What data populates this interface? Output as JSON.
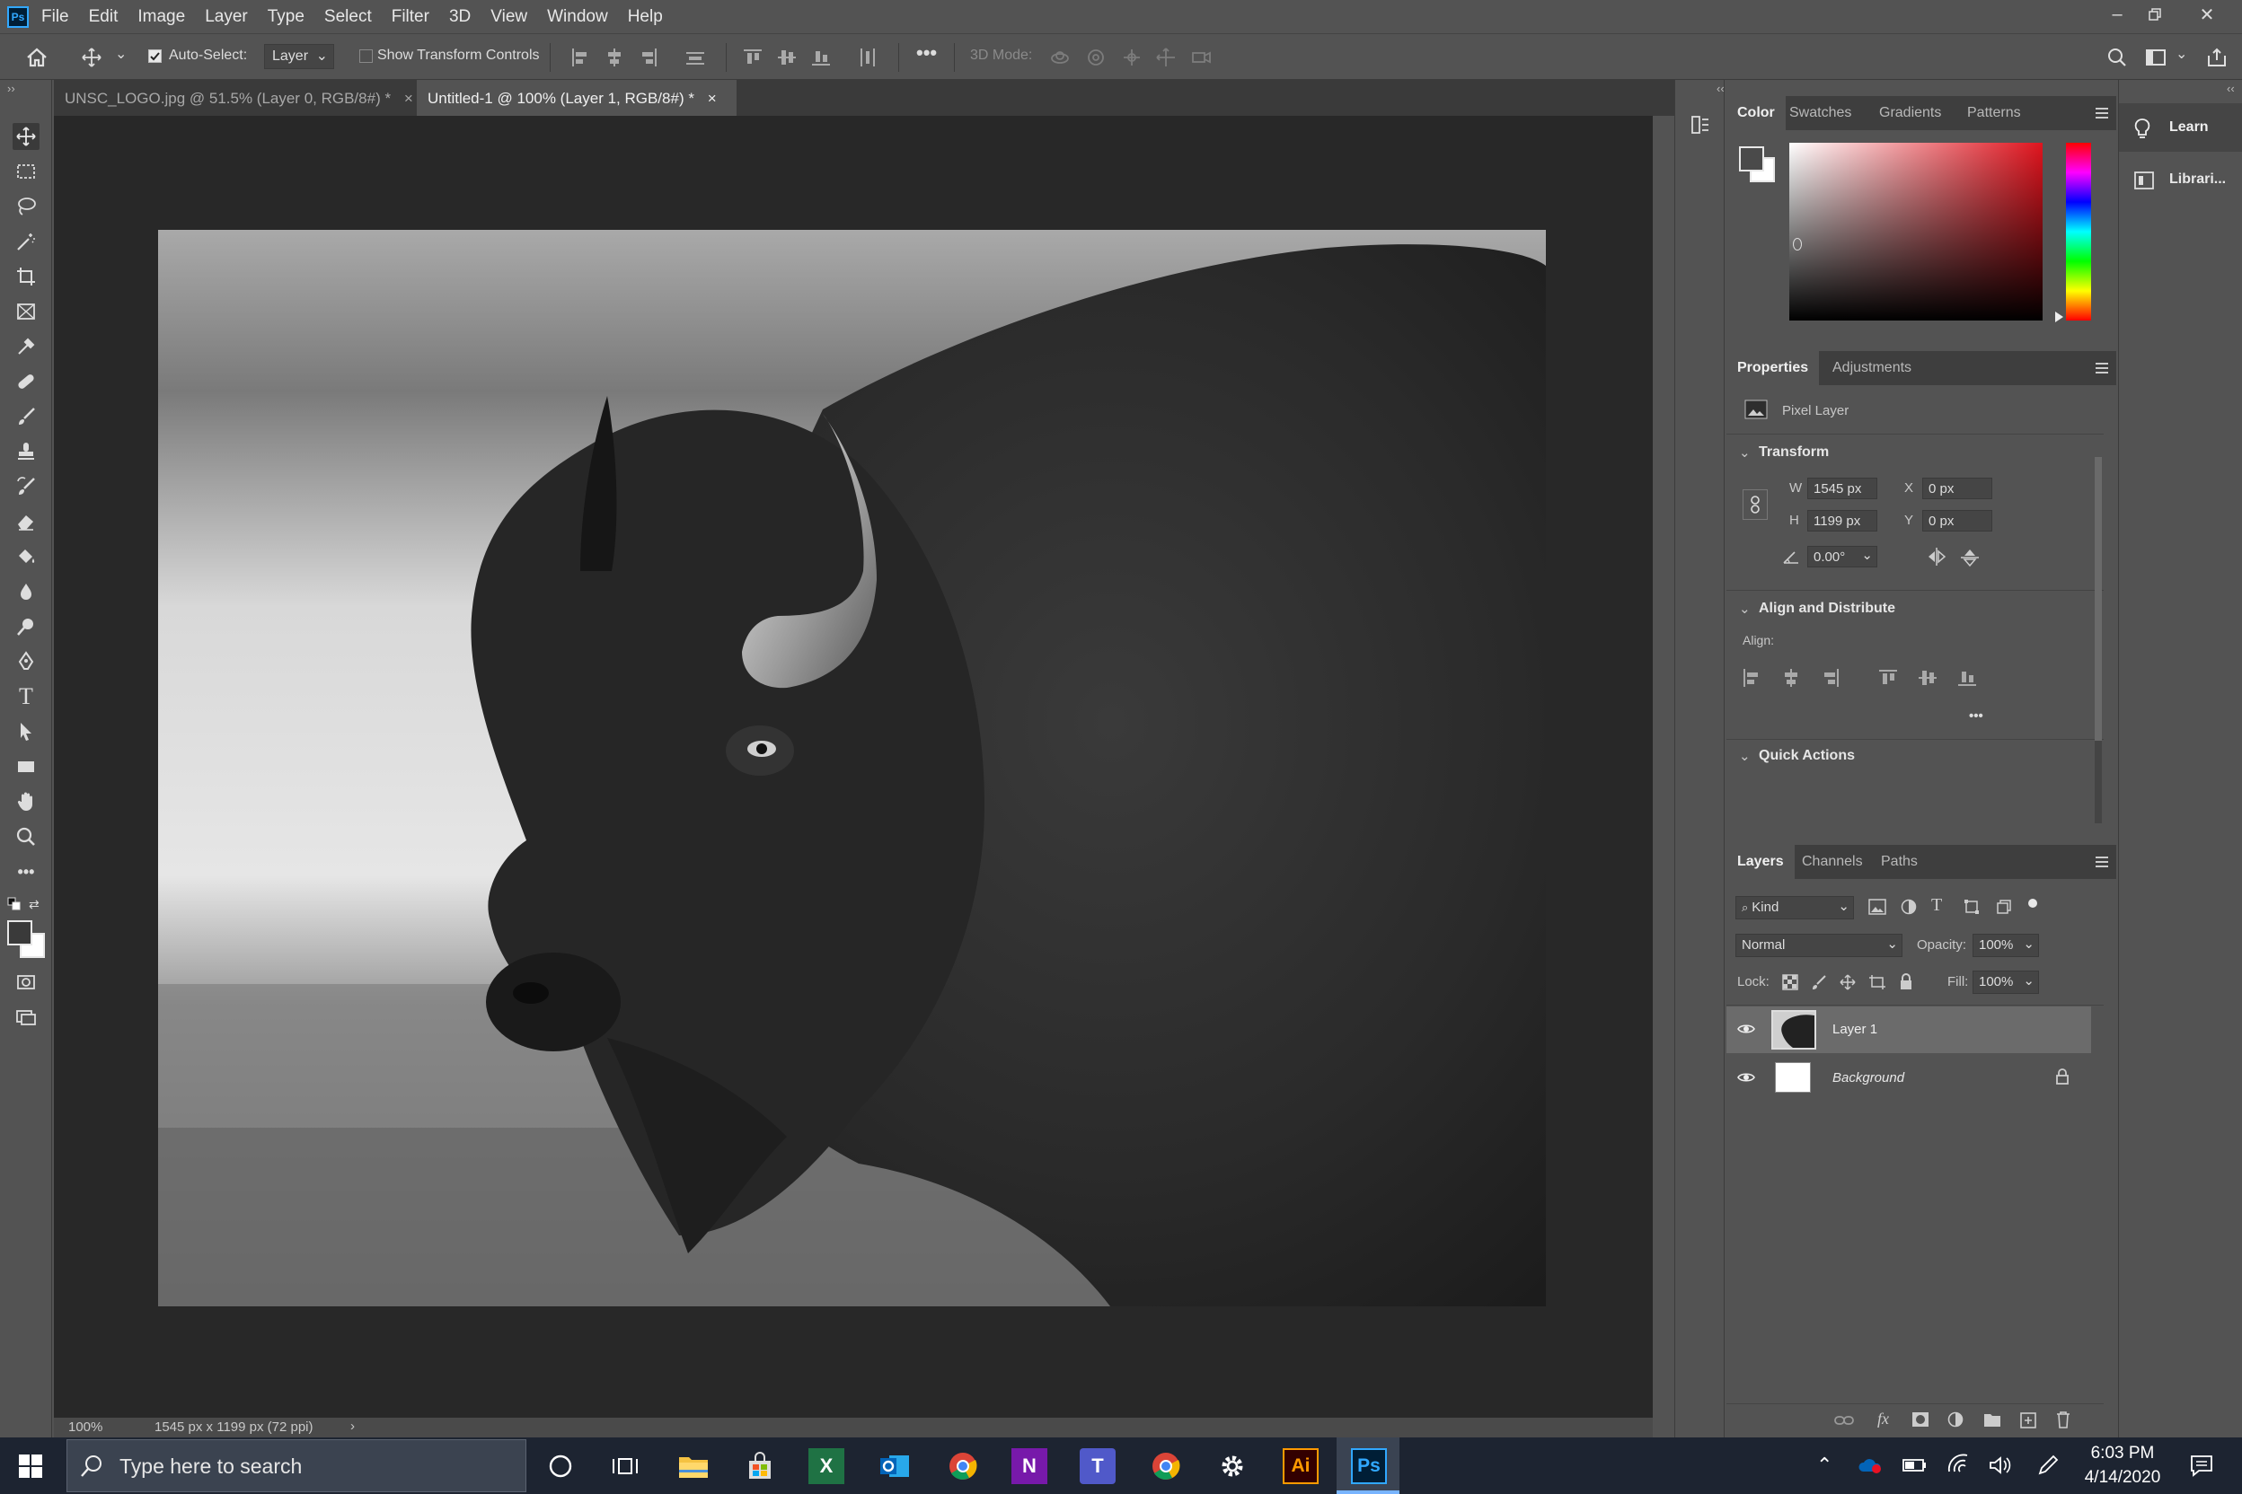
{
  "app": {
    "logo": "Ps"
  },
  "menu": [
    "File",
    "Edit",
    "Image",
    "Layer",
    "Type",
    "Select",
    "Filter",
    "3D",
    "View",
    "Window",
    "Help"
  ],
  "options_bar": {
    "auto_select_label": "Auto-Select:",
    "auto_select_checked": true,
    "auto_select_target": "Layer",
    "show_transform_label": "Show Transform Controls",
    "mode3d_label": "3D Mode:"
  },
  "tabs": [
    {
      "label": "UNSC_LOGO.jpg @ 51.5% (Layer 0, RGB/8#) *",
      "close": "×",
      "active": false
    },
    {
      "label": "Untitled-1 @ 100% (Layer 1, RGB/8#) *",
      "close": "×",
      "active": true
    }
  ],
  "status": {
    "zoom": "100%",
    "dimensions": "1545 px x 1199 px (72 ppi)",
    "arrow": "›"
  },
  "color_panel": {
    "tabs": [
      "Color",
      "Swatches",
      "Gradients",
      "Patterns"
    ],
    "active": "Color",
    "hue_color": "#e0141e"
  },
  "properties_panel": {
    "tabs": [
      "Properties",
      "Adjustments"
    ],
    "active": "Properties",
    "layer_type": "Pixel Layer",
    "transform_title": "Transform",
    "w_label": "W",
    "w_value": "1545 px",
    "h_label": "H",
    "h_value": "1199 px",
    "x_label": "X",
    "x_value": "0 px",
    "y_label": "Y",
    "y_value": "0 px",
    "angle_value": "0.00°",
    "align_title": "Align and Distribute",
    "align_label": "Align:",
    "more": "•••",
    "quick_actions_title": "Quick Actions"
  },
  "layers_panel": {
    "tabs": [
      "Layers",
      "Channels",
      "Paths"
    ],
    "active": "Layers",
    "filter_label": "Kind",
    "blend_mode": "Normal",
    "opacity_label": "Opacity:",
    "opacity_value": "100%",
    "lock_label": "Lock:",
    "fill_label": "Fill:",
    "fill_value": "100%",
    "layers": [
      {
        "name": "Layer 1",
        "visible": true,
        "selected": true,
        "locked": false
      },
      {
        "name": "Background",
        "visible": true,
        "selected": false,
        "locked": true
      }
    ]
  },
  "side_panels": {
    "learn": "Learn",
    "libraries": "Librari..."
  },
  "taskbar": {
    "search_placeholder": "Type here to search",
    "time": "6:03 PM",
    "date": "4/14/2020",
    "apps": [
      "cortana-icon",
      "task-view-icon",
      "file-explorer-icon",
      "store-icon",
      "excel-icon",
      "outlook-icon",
      "chrome-icon",
      "onenote-icon",
      "teams-icon",
      "chrome-icon",
      "settings-icon",
      "illustrator-icon",
      "photoshop-icon"
    ],
    "excel_label": "X",
    "onenote_label": "N",
    "teams_label": "T",
    "illustrator_label": "Ai",
    "photoshop_label": "Ps"
  }
}
